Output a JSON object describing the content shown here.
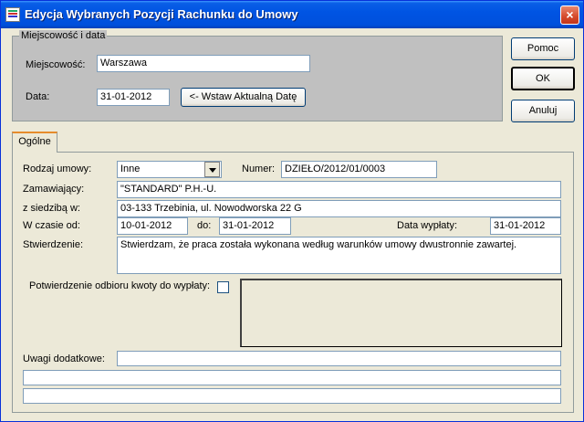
{
  "window": {
    "title": "Edycja Wybranych Pozycji Rachunku do Umowy",
    "close_label": "×"
  },
  "location_group": {
    "legend": "Miejscowość i data",
    "city_label": "Miejscowość:",
    "city_value": "Warszawa",
    "date_label": "Data:",
    "date_value": "31-01-2012",
    "insert_date_button": "<- Wstaw Aktualną Datę"
  },
  "buttons": {
    "help": "Pomoc",
    "ok": "OK",
    "cancel": "Anuluj"
  },
  "tabs": [
    {
      "label": "Ogólne",
      "selected": true
    }
  ],
  "form": {
    "contract_type_label": "Rodzaj umowy:",
    "contract_type_value": "Inne",
    "number_label": "Numer:",
    "number_value": "DZIEŁO/2012/01/0003",
    "ordering_party_label": "Zamawiający:",
    "ordering_party_value": "\"STANDARD\" P.H.-U.",
    "seat_label": "z siedzibą w:",
    "seat_value": "03-133 Trzebinia, ul. Nowodworska 22 G",
    "period_from_label": "W czasie od:",
    "period_from_value": "10-01-2012",
    "period_to_label": "do:",
    "period_to_value": "31-01-2012",
    "payment_date_label": "Data wypłaty:",
    "payment_date_value": "31-01-2012",
    "statement_label": "Stwierdzenie:",
    "statement_value": "Stwierdzam, że praca została wykonana według warunków umowy dwustronnie zawartej.",
    "receipt_confirmation_label": "Potwierdzenie odbioru kwoty do wypłaty:",
    "receipt_confirmation_checked": false,
    "remarks_label": "Uwagi dodatkowe:",
    "remarks_line1": "",
    "remarks_line2": "",
    "remarks_line3": ""
  }
}
